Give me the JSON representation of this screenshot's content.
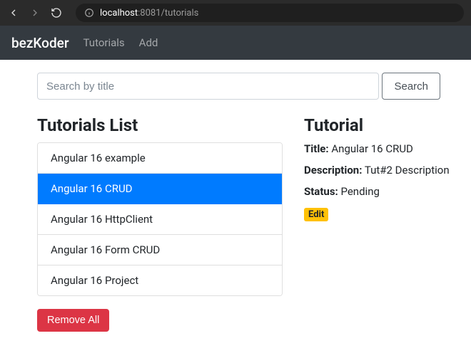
{
  "browser": {
    "url_host": "localhost",
    "url_port_path": ":8081/tutorials"
  },
  "navbar": {
    "brand": "bezKoder",
    "links": [
      "Tutorials",
      "Add"
    ]
  },
  "search": {
    "placeholder": "Search by title",
    "button_label": "Search"
  },
  "list": {
    "title": "Tutorials List",
    "items": [
      "Angular 16 example",
      "Angular 16 CRUD",
      "Angular 16 HttpClient",
      "Angular 16 Form CRUD",
      "Angular 16 Project"
    ],
    "selected_index": 1,
    "remove_label": "Remove All"
  },
  "detail": {
    "heading": "Tutorial",
    "title_label": "Title:",
    "title_value": "Angular 16 CRUD",
    "description_label": "Description:",
    "description_value": "Tut#2 Description",
    "status_label": "Status:",
    "status_value": "Pending",
    "edit_label": "Edit"
  }
}
